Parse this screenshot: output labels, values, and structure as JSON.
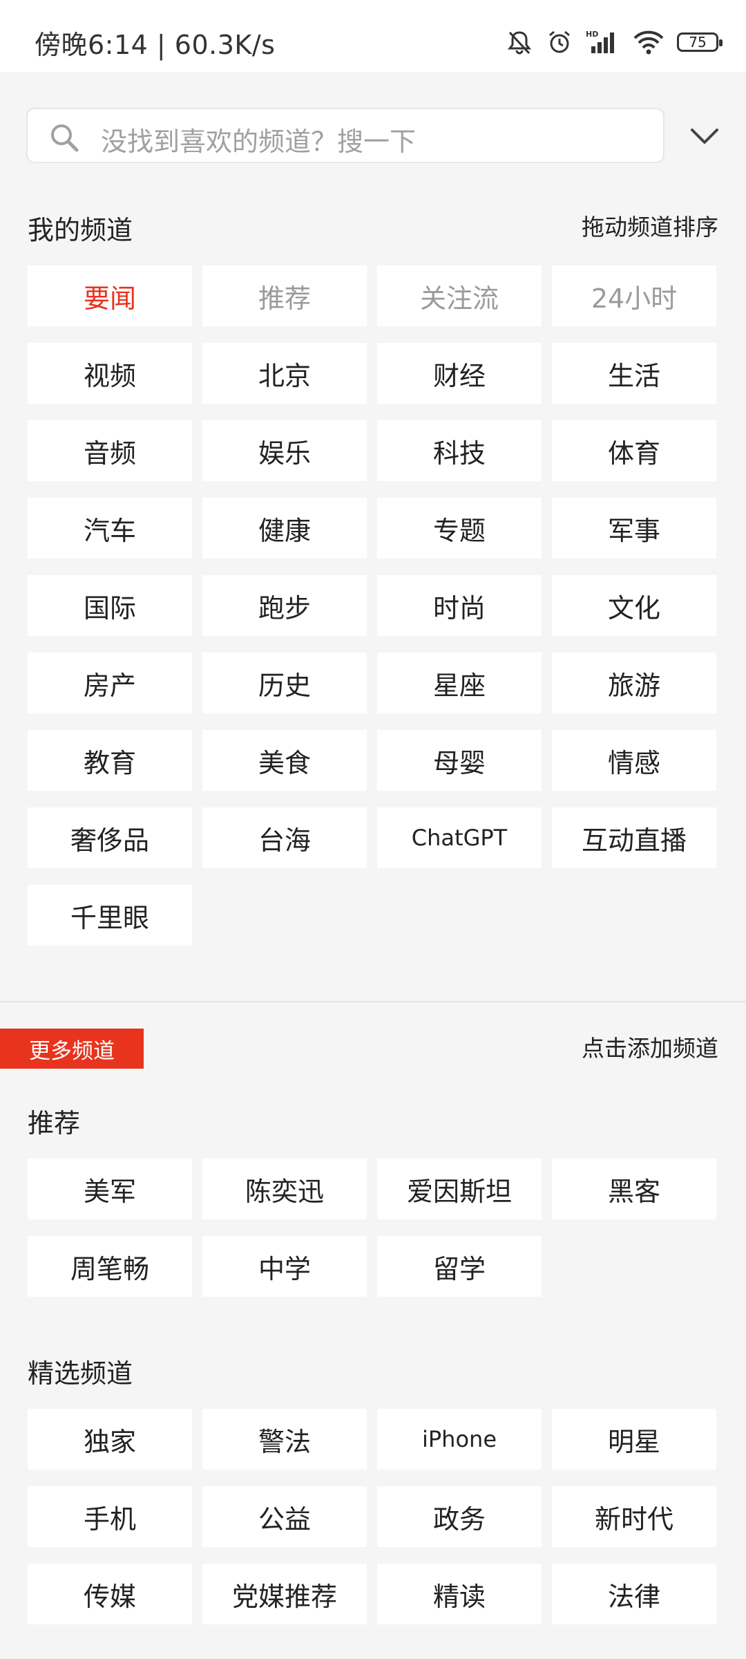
{
  "status": {
    "time": "傍晚6:14 | 60.3K/s",
    "battery": "75",
    "icons": [
      "bell-off-icon",
      "alarm-icon",
      "hd-signal-icon",
      "wifi-icon",
      "battery-icon"
    ]
  },
  "search": {
    "placeholder": "没找到喜欢的频道？搜一下",
    "icon": "search-icon",
    "collapse_icon": "chevron-down-icon"
  },
  "my_channels": {
    "title": "我的频道",
    "hint": "拖动频道排序",
    "items": [
      "要闻",
      "推荐",
      "关注流",
      "24小时",
      "视频",
      "北京",
      "财经",
      "生活",
      "音频",
      "娱乐",
      "科技",
      "体育",
      "汽车",
      "健康",
      "专题",
      "军事",
      "国际",
      "跑步",
      "时尚",
      "文化",
      "房产",
      "历史",
      "星座",
      "旅游",
      "教育",
      "美食",
      "母婴",
      "情感",
      "奢侈品",
      "台海",
      "ChatGPT",
      "互动直播",
      "千里眼"
    ],
    "active_index": 0,
    "fixed_indices": [
      1,
      2,
      3
    ]
  },
  "more_channels": {
    "badge": "更多频道",
    "hint": "点击添加频道"
  },
  "recommended": {
    "title": "推荐",
    "items": [
      "美军",
      "陈奕迅",
      "爱因斯坦",
      "黑客",
      "周笔畅",
      "中学",
      "留学"
    ]
  },
  "featured": {
    "title": "精选频道",
    "items": [
      "独家",
      "警法",
      "iPhone",
      "明星",
      "手机",
      "公益",
      "政务",
      "新时代",
      "传媒",
      "党媒推荐",
      "精读",
      "法律"
    ]
  },
  "colors": {
    "accent": "#e8331d",
    "background": "#f5f5f5",
    "chip": "#ffffff",
    "muted_text": "#9a9a9a"
  }
}
